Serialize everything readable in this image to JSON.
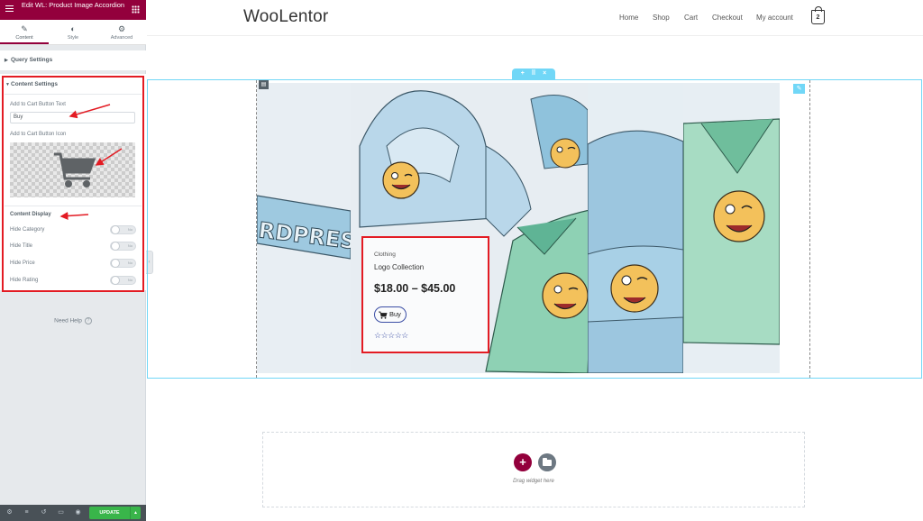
{
  "editor": {
    "title": "Edit WL: Product Image Accordion",
    "tabs": [
      {
        "label": "Content",
        "icon": "pencil-icon",
        "active": true
      },
      {
        "label": "Style",
        "icon": "half-circle-icon",
        "active": false
      },
      {
        "label": "Advanced",
        "icon": "gear-icon",
        "active": false
      }
    ],
    "query_settings": "Query Settings",
    "content_settings": {
      "title": "Content Settings",
      "cart_text_label": "Add to Cart Button Text",
      "cart_text_value": "Buy",
      "cart_icon_label": "Add to Cart Button Icon",
      "cart_icon": "shopping-cart-icon"
    },
    "content_display": {
      "title": "Content Display",
      "toggles": [
        {
          "label": "Hide Category",
          "state": "No",
          "on": false
        },
        {
          "label": "Hide Title",
          "state": "No",
          "on": false
        },
        {
          "label": "Hide Price",
          "state": "No",
          "on": false
        },
        {
          "label": "Hide Rating",
          "state": "No",
          "on": false
        }
      ]
    },
    "need_help": "Need Help",
    "footer": {
      "update": "UPDATE"
    },
    "accent": "#93003c",
    "highlight": "#e31b23"
  },
  "site": {
    "logo": "WooLentor",
    "nav": [
      "Home",
      "Shop",
      "Cart",
      "Checkout",
      "My account"
    ],
    "cart_count": "2"
  },
  "product": {
    "category": "Clothing",
    "title": "Logo Collection",
    "price": "$18.00 – $45.00",
    "button": "Buy",
    "rating": "☆☆☆☆☆",
    "banner_text": "RDPRESS"
  },
  "drop_zone": {
    "hint": "Drag widget here"
  }
}
